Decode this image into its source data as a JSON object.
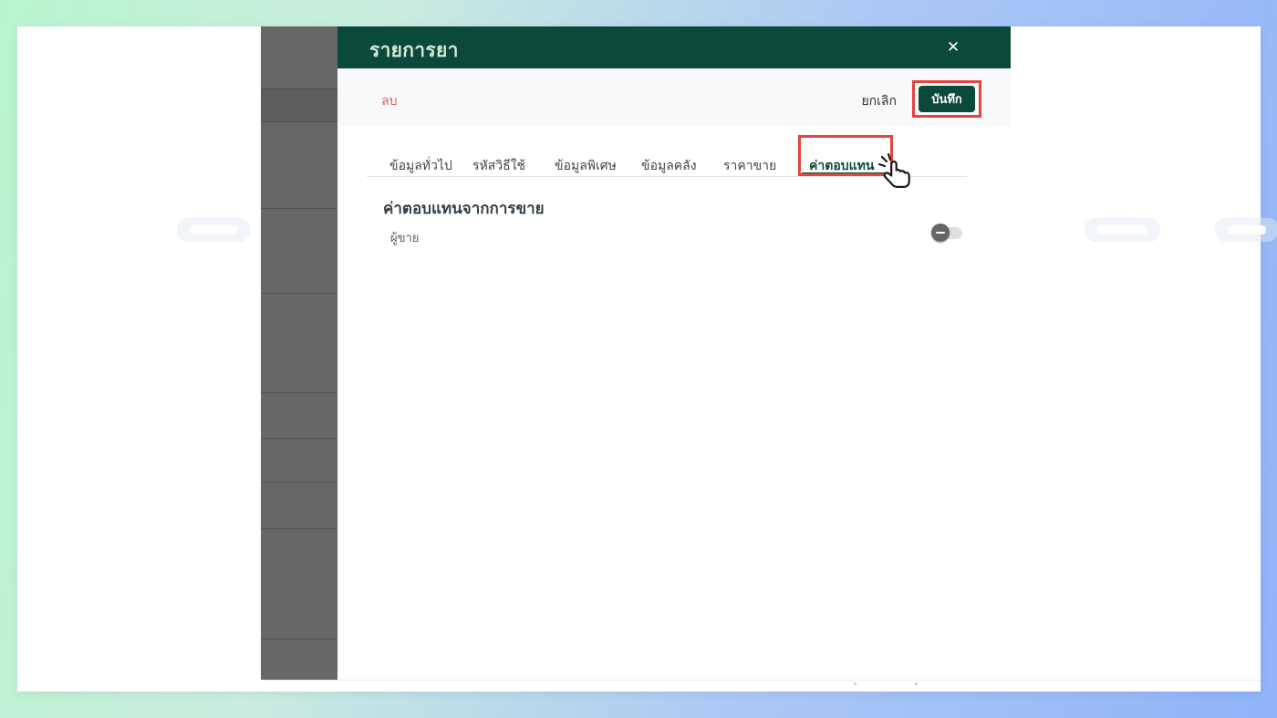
{
  "modal": {
    "title": "รายการยา",
    "close_icon": "✕",
    "toolbar": {
      "delete_label": "ลบ",
      "cancel_label": "ยกเลิก",
      "save_label": "บันทึก"
    },
    "tabs": [
      {
        "label": "ข้อมูลทั่วไป",
        "active": false
      },
      {
        "label": "รหัสวิธีใช้",
        "active": false
      },
      {
        "label": "ข้อมูลพิเศษ",
        "active": false
      },
      {
        "label": "ข้อมูลคลัง",
        "active": false
      },
      {
        "label": "ราคาขาย",
        "active": false
      },
      {
        "label": "ค่าตอบแทน",
        "active": true
      }
    ],
    "content": {
      "section_heading": "ค่าตอบแทนจากการขาย",
      "rows": [
        {
          "label": "ผู้ขาย",
          "control": "toggle-switch",
          "state": "off"
        }
      ]
    }
  },
  "annotations": {
    "highlighted_elements": [
      "save-button",
      "tab-compensation"
    ],
    "cursor_icon": "hand-click-icon",
    "highlight_color": "#e5433e"
  },
  "colors": {
    "brand_green": "#0b4a3b",
    "danger_red": "#e05c5c",
    "annotation_red": "#e5433e",
    "dimmed_column_gray": "#676767"
  }
}
